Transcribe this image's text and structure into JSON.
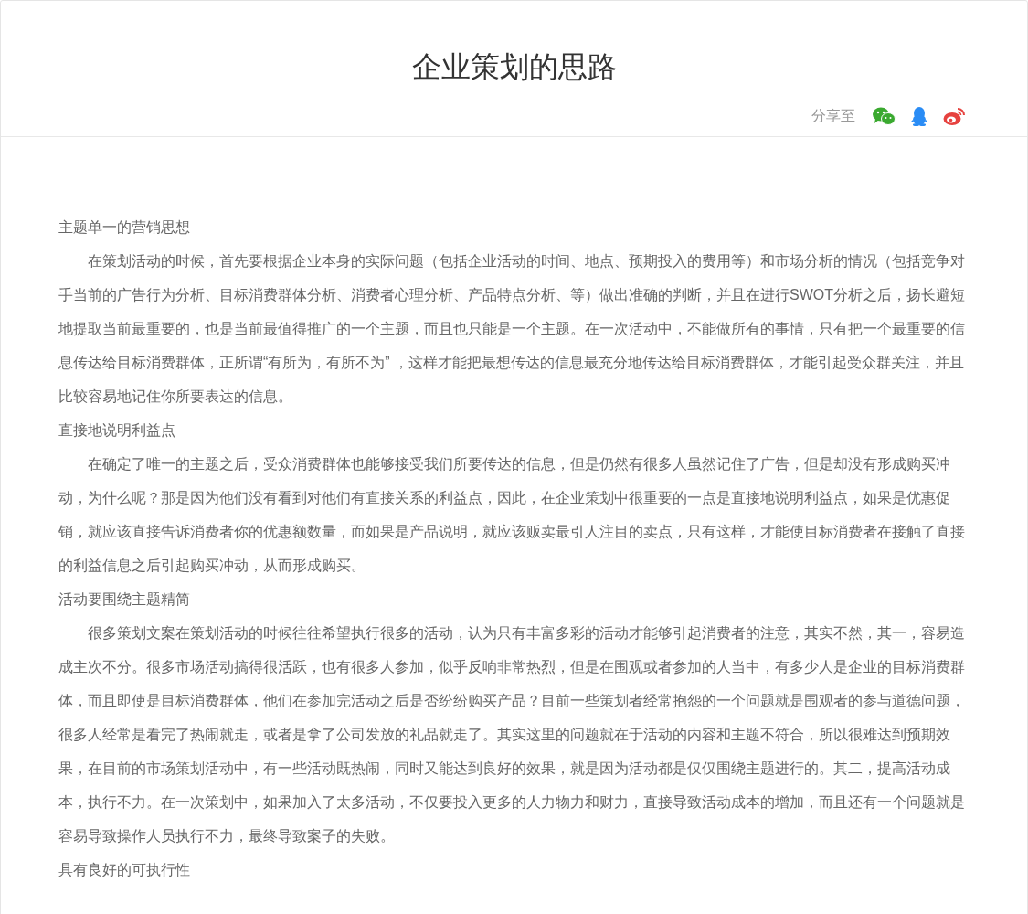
{
  "article": {
    "title": "企业策划的思路",
    "share_label": "分享至",
    "share_targets": [
      {
        "kind": "wechat"
      },
      {
        "kind": "qq"
      },
      {
        "kind": "weibo"
      }
    ],
    "blocks": [
      {
        "kind": "heading",
        "text": "主题单一的营销思想"
      },
      {
        "kind": "paragraph",
        "text": "在策划活动的时候，首先要根据企业本身的实际问题（包括企业活动的时间、地点、预期投入的费用等）和市场分析的情况（包括竞争对手当前的广告行为分析、目标消费群体分析、消费者心理分析、产品特点分析、等）做出准确的判断，并且在进行SWOT分析之后，扬长避短地提取当前最重要的，也是当前最值得推广的一个主题，而且也只能是一个主题。在一次活动中，不能做所有的事情，只有把一个最重要的信息传达给目标消费群体，正所谓“有所为，有所不为” ，这样才能把最想传达的信息最充分地传达给目标消费群体，才能引起受众群关注，并且比较容易地记住你所要表达的信息。"
      },
      {
        "kind": "heading",
        "text": "直接地说明利益点"
      },
      {
        "kind": "paragraph",
        "text": "在确定了唯一的主题之后，受众消费群体也能够接受我们所要传达的信息，但是仍然有很多人虽然记住了广告，但是却没有形成购买冲动，为什么呢？那是因为他们没有看到对他们有直接关系的利益点，因此，在企业策划中很重要的一点是直接地说明利益点，如果是优惠促销，就应该直接告诉消费者你的优惠额数量，而如果是产品说明，就应该贩卖最引人注目的卖点，只有这样，才能使目标消费者在接触了直接的利益信息之后引起购买冲动，从而形成购买。"
      },
      {
        "kind": "heading",
        "text": "活动要围绕主题精简"
      },
      {
        "kind": "paragraph",
        "text": "很多策划文案在策划活动的时候往往希望执行很多的活动，认为只有丰富多彩的活动才能够引起消费者的注意，其实不然，其一，容易造成主次不分。很多市场活动搞得很活跃，也有很多人参加，似乎反响非常热烈，但是在围观或者参加的人当中，有多少人是企业的目标消费群体，而且即使是目标消费群体，他们在参加完活动之后是否纷纷购买产品？目前一些策划者经常抱怨的一个问题就是围观者的参与道德问题，很多人经常是看完了热闹就走，或者是拿了公司发放的礼品就走了。其实这里的问题就在于活动的内容和主题不符合，所以很难达到预期效果，在目前的市场策划活动中，有一些活动既热闹，同时又能达到良好的效果，就是因为活动都是仅仅围绕主题进行的。其二，提高活动成本，执行不力。在一次策划中，如果加入了太多活动，不仅要投入更多的人力物力和财力，直接导致活动成本的增加，而且还有一个问题就是容易导致操作人员执行不力，最终导致案子的失败。"
      },
      {
        "kind": "heading",
        "text": "具有良好的可执行性"
      }
    ]
  }
}
